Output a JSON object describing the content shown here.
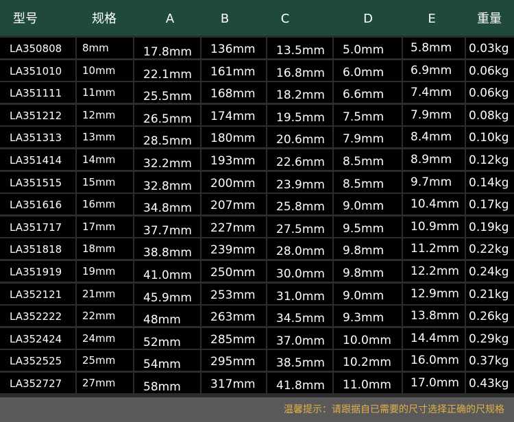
{
  "table": {
    "headers": [
      "型号",
      "规格",
      "A",
      "B",
      "C",
      "D",
      "E",
      "重量"
    ],
    "rows": [
      [
        "LA350808",
        "8mm",
        "17.8mm",
        "136mm",
        "13.5mm",
        "5.0mm",
        "5.8mm",
        "0.03kg"
      ],
      [
        "LA351010",
        "10mm",
        "22.1mm",
        "161mm",
        "16.8mm",
        "6.0mm",
        "6.9mm",
        "0.06kg"
      ],
      [
        "LA351111",
        "11mm",
        "25.5mm",
        "168mm",
        "18.2mm",
        "6.6mm",
        "7.4mm",
        "0.06kg"
      ],
      [
        "LA351212",
        "12mm",
        "26.5mm",
        "174mm",
        "19.5mm",
        "7.5mm",
        "7.9mm",
        "0.08kg"
      ],
      [
        "LA351313",
        "13mm",
        "28.5mm",
        "180mm",
        "20.6mm",
        "7.9mm",
        "8.4mm",
        "0.10kg"
      ],
      [
        "LA351414",
        "14mm",
        "32.2mm",
        "193mm",
        "22.6mm",
        "8.5mm",
        "8.9mm",
        "0.12kg"
      ],
      [
        "LA351515",
        "15mm",
        "32.8mm",
        "200mm",
        "23.9mm",
        "8.5mm",
        "9.7mm",
        "0.14kg"
      ],
      [
        "LA351616",
        "16mm",
        "34.8mm",
        "207mm",
        "25.8mm",
        "9.0mm",
        "10.4mm",
        "0.17kg"
      ],
      [
        "LA351717",
        "17mm",
        "37.7mm",
        "227mm",
        "27.5mm",
        "9.5mm",
        "10.9mm",
        "0.19kg"
      ],
      [
        "LA351818",
        "18mm",
        "38.8mm",
        "239mm",
        "28.0mm",
        "9.8mm",
        "11.2mm",
        "0.22kg"
      ],
      [
        "LA351919",
        "19mm",
        "41.0mm",
        "250mm",
        "30.0mm",
        "9.8mm",
        "12.2mm",
        "0.24kg"
      ],
      [
        "LA352121",
        "21mm",
        "45.9mm",
        "253mm",
        "31.0mm",
        "9.0mm",
        "12.9mm",
        "0.21kg"
      ],
      [
        "LA352222",
        "22mm",
        "48mm",
        "263mm",
        "34.5mm",
        "9.3mm",
        "13.8mm",
        "0.26kg"
      ],
      [
        "LA352424",
        "24mm",
        "52mm",
        "285mm",
        "37.0mm",
        "10.0mm",
        "14.4mm",
        "0.29kg"
      ],
      [
        "LA352525",
        "25mm",
        "54mm",
        "295mm",
        "38.5mm",
        "10.2mm",
        "16.0mm",
        "0.37kg"
      ],
      [
        "LA352727",
        "27mm",
        "58mm",
        "317mm",
        "41.8mm",
        "11.0mm",
        "17.0mm",
        "0.43kg"
      ]
    ]
  },
  "footer": {
    "note": "温馨提示：请跟据自已需要的尺寸选择正确的尺规格"
  },
  "colors": {
    "header_bg": "#1f4a3a",
    "cell_bg": "#000000",
    "grid_line": "#2c2c2c",
    "footer_bg": "#595959",
    "footer_text": "#e0b04a"
  }
}
